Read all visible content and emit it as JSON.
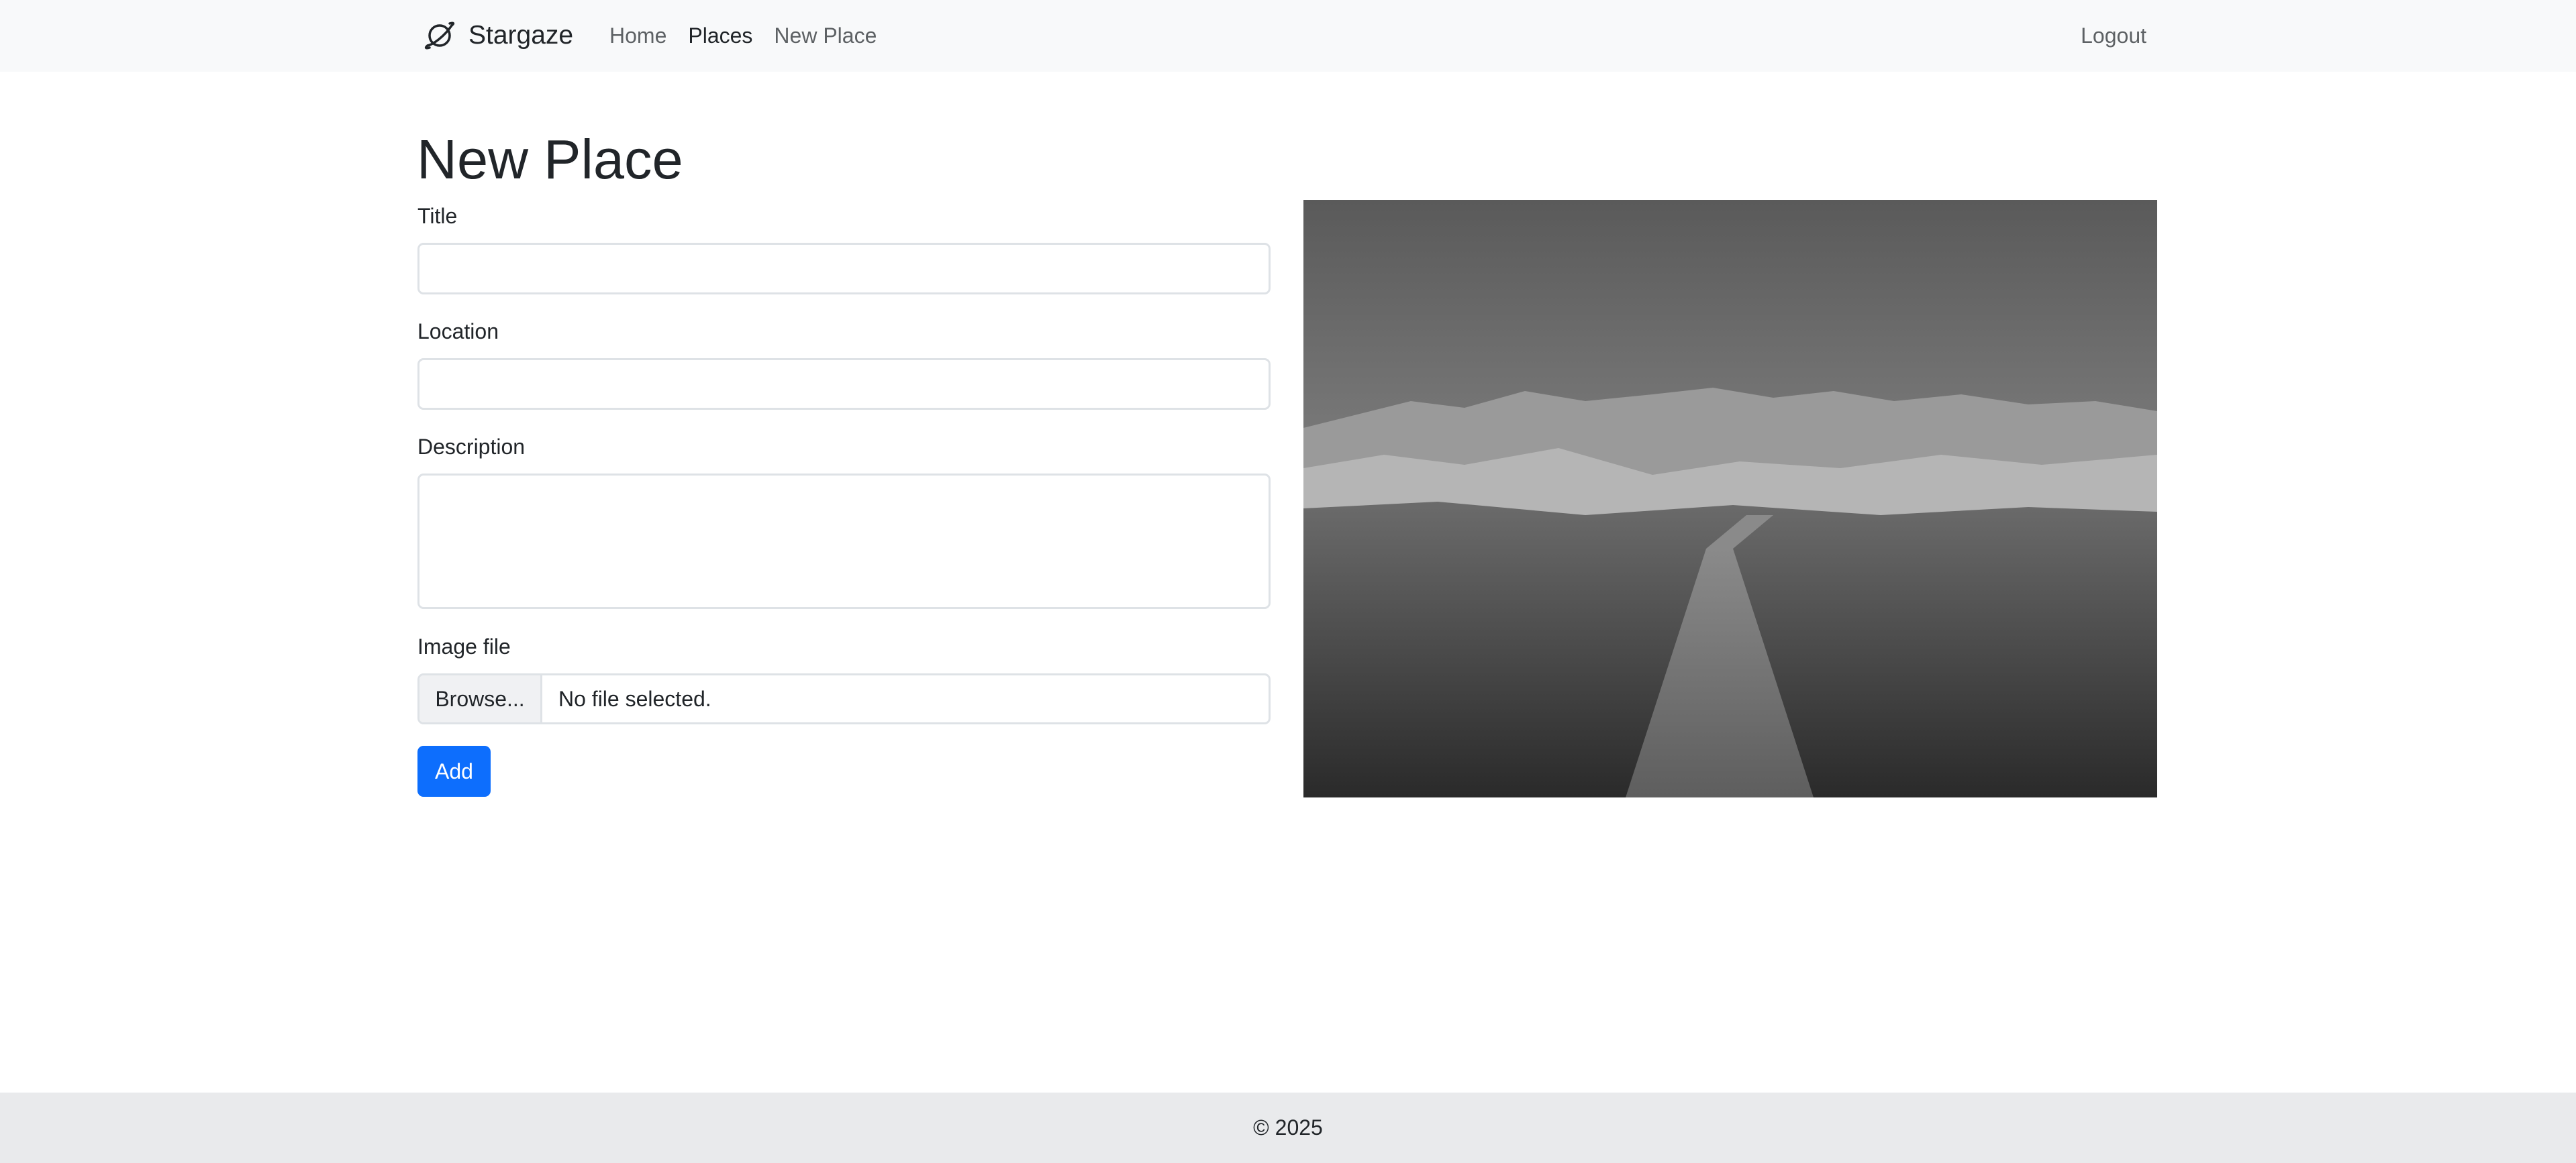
{
  "navbar": {
    "brand": "Stargaze",
    "links": [
      "Home",
      "Places",
      "New Place"
    ],
    "active_link": "Places",
    "logout": "Logout"
  },
  "page": {
    "title": "New Place"
  },
  "form": {
    "title_label": "Title",
    "title_value": "",
    "location_label": "Location",
    "location_value": "",
    "description_label": "Description",
    "description_value": "",
    "image_label": "Image file",
    "browse_label": "Browse...",
    "file_status": "No file selected.",
    "submit_label": "Add"
  },
  "footer": {
    "text": "© 2025"
  },
  "colors": {
    "navbar_bg": "#f8f9fa",
    "primary": "#0d6efd",
    "footer_bg": "#e9eaec"
  },
  "icons": {
    "brand": "planet-icon"
  }
}
